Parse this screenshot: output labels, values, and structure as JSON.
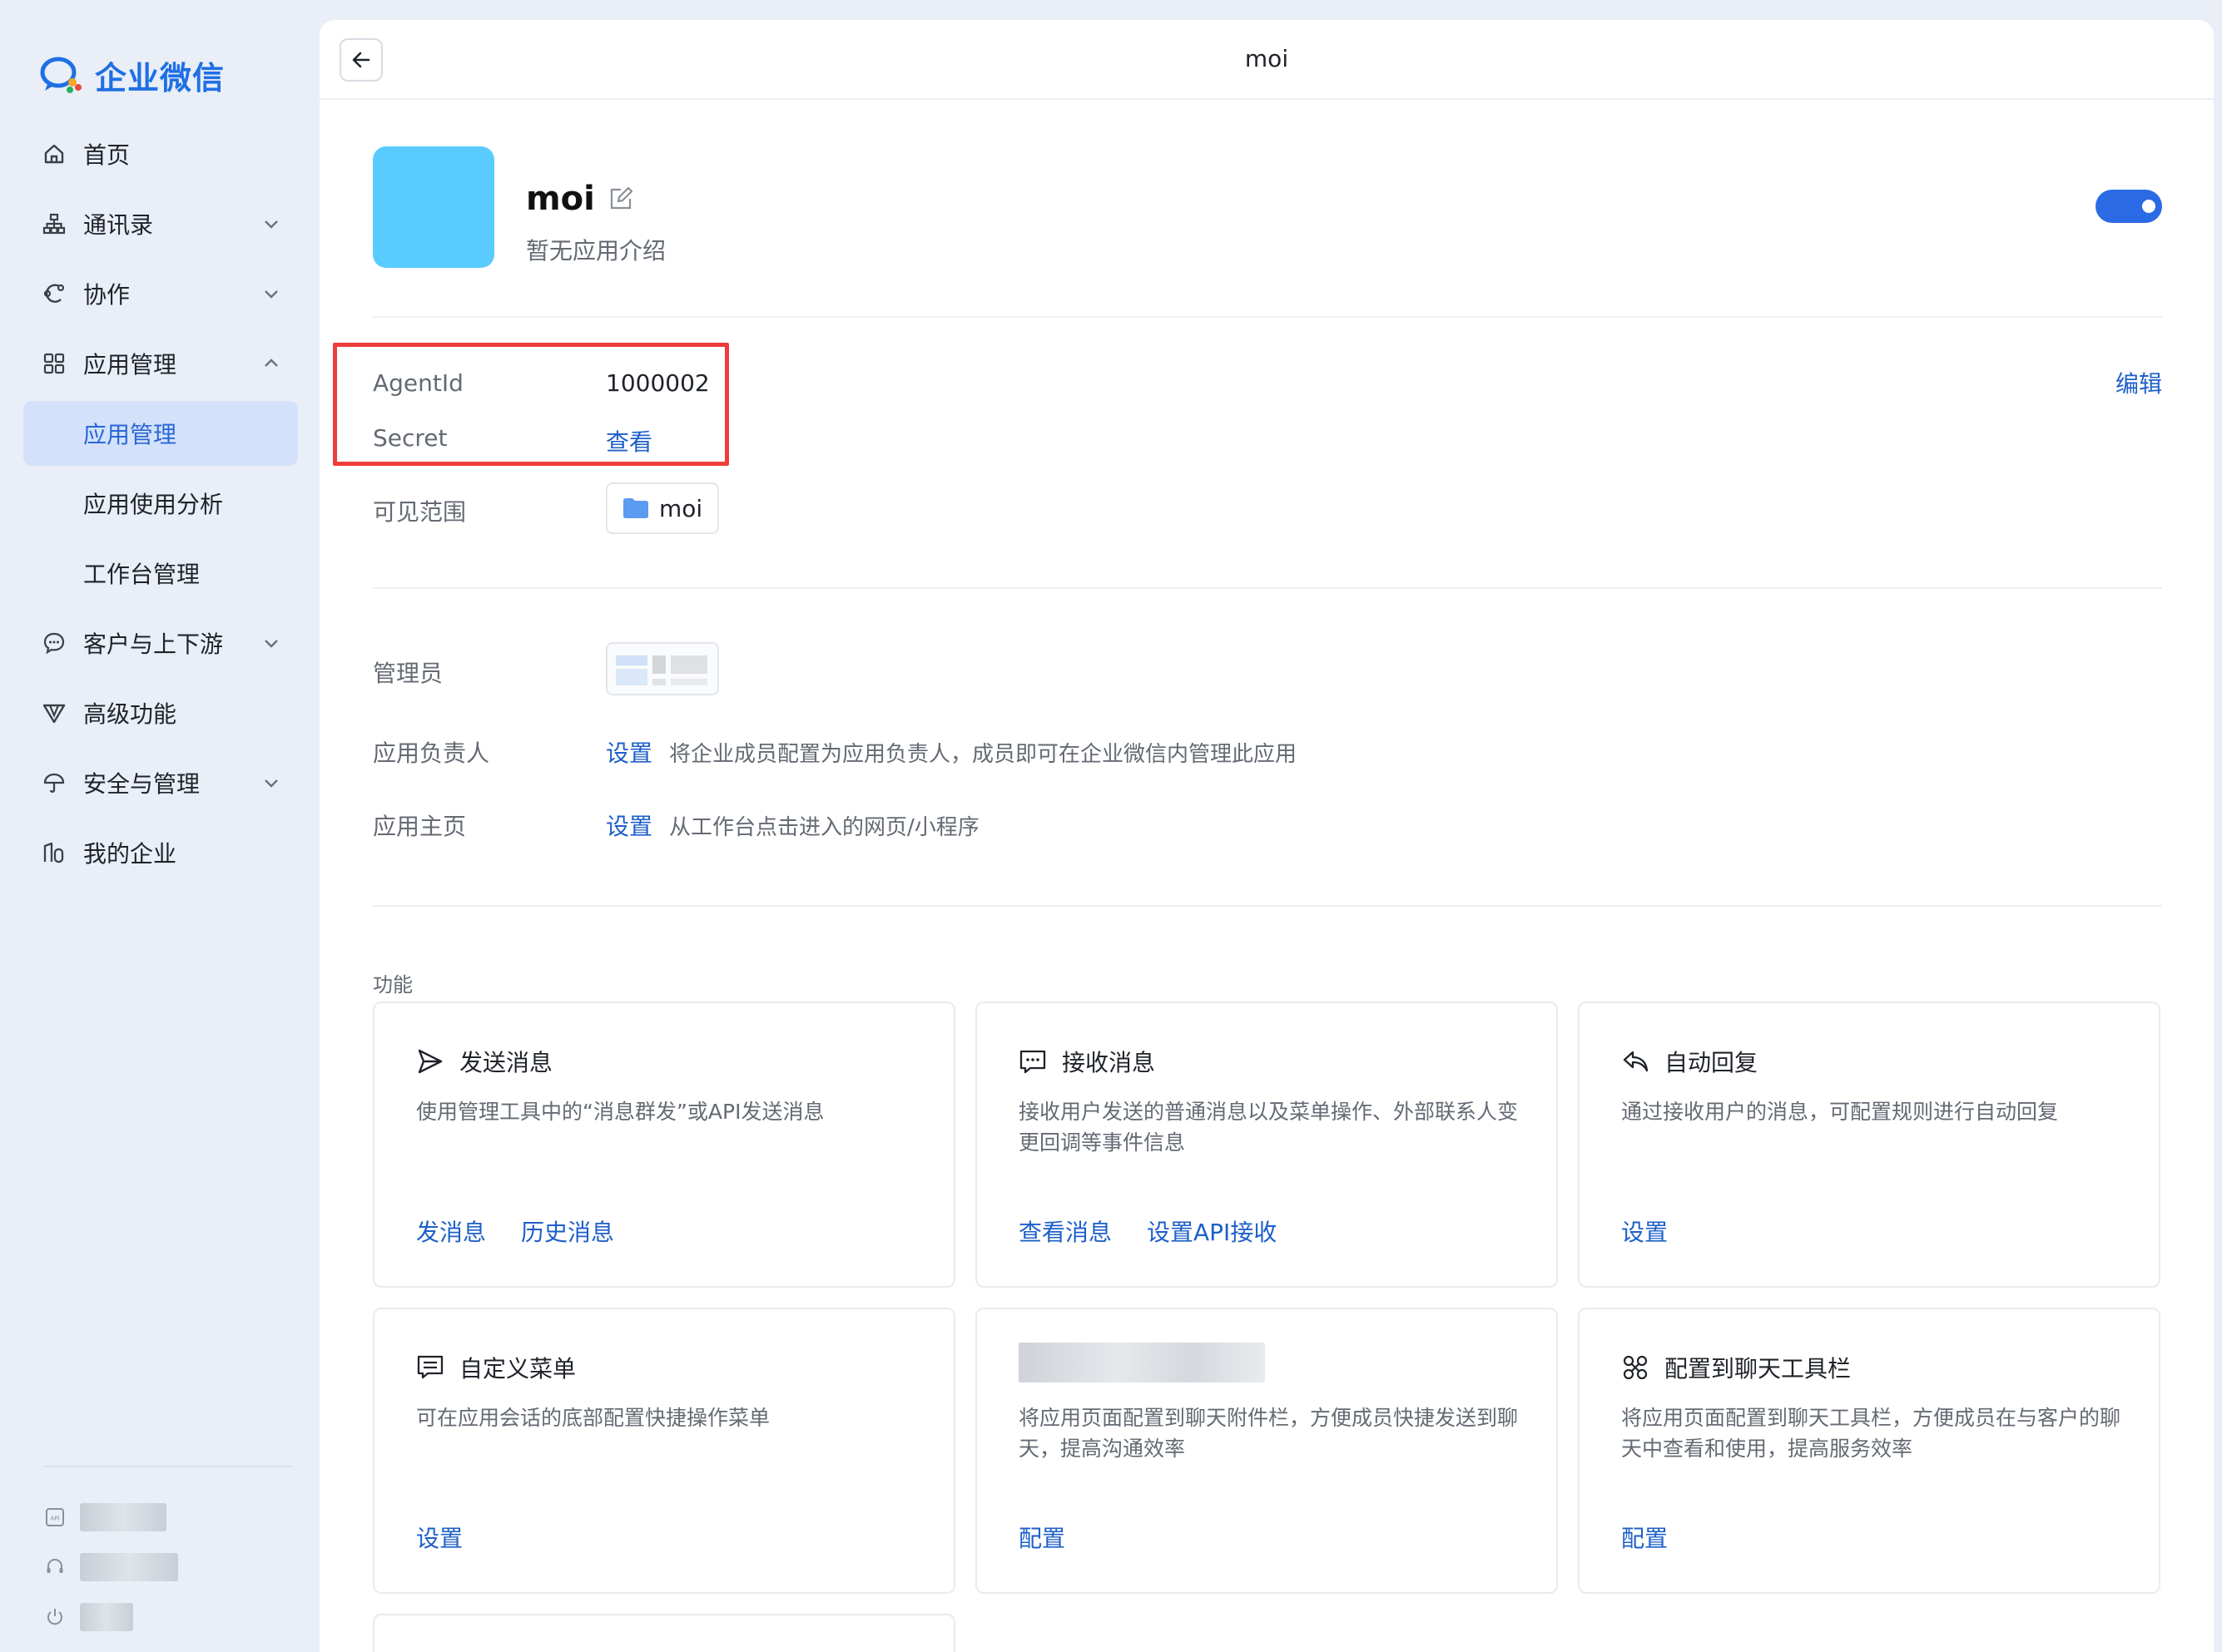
{
  "brand": {
    "name": "企业微信",
    "accent": "#1f6fe5"
  },
  "sidebar": {
    "items": [
      {
        "label": "首页",
        "icon": "home-icon"
      },
      {
        "label": "通讯录",
        "icon": "org-chart-icon"
      },
      {
        "label": "协作",
        "icon": "collaborate-icon"
      },
      {
        "label": "应用管理",
        "icon": "grid-icon"
      },
      {
        "label": "应用管理"
      },
      {
        "label": "应用使用分析"
      },
      {
        "label": "工作台管理"
      },
      {
        "label": "客户与上下游",
        "icon": "chat-bubble-icon"
      },
      {
        "label": "高级功能",
        "icon": "v-badge-icon"
      },
      {
        "label": "安全与管理",
        "icon": "umbrella-icon"
      },
      {
        "label": "我的企业",
        "icon": "building-icon"
      }
    ]
  },
  "topbar": {
    "title": "moi"
  },
  "app": {
    "name": "moi",
    "description": "暂无应用介绍",
    "enabled": true
  },
  "info": {
    "agentid_label": "AgentId",
    "agentid_value": "1000002",
    "secret_label": "Secret",
    "secret_link": "查看",
    "edit_link": "编辑",
    "visible_label": "可见范围",
    "visible_value": "moi"
  },
  "admin": {
    "admin_label": "管理员",
    "owner_label": "应用负责人",
    "owner_link": "设置",
    "owner_hint": "将企业成员配置为应用负责人，成员即可在企业微信内管理此应用",
    "home_label": "应用主页",
    "home_link": "设置",
    "home_hint": "从工作台点击进入的网页/小程序"
  },
  "features": {
    "section_label": "功能",
    "cards": [
      {
        "title": "发送消息",
        "desc": "使用管理工具中的“消息群发”或API发送消息",
        "links": [
          "发消息",
          "历史消息"
        ]
      },
      {
        "title": "接收消息",
        "desc": "接收用户发送的普通消息以及菜单操作、外部联系人变更回调等事件信息",
        "links": [
          "查看消息",
          "设置API接收"
        ]
      },
      {
        "title": "自动回复",
        "desc": "通过接收用户的消息，可配置规则进行自动回复",
        "links": [
          "设置"
        ]
      },
      {
        "title": "自定义菜单",
        "desc": "可在应用会话的底部配置快捷操作菜单",
        "links": [
          "设置"
        ]
      },
      {
        "title": "",
        "desc": "将应用页面配置到聊天附件栏，方便成员快捷发送到聊天，提高沟通效率",
        "links": [
          "配置"
        ]
      },
      {
        "title": "配置到聊天工具栏",
        "desc": "将应用页面配置到聊天工具栏，方便成员在与客户的聊天中查看和使用，提高服务效率",
        "links": [
          "配置"
        ]
      }
    ]
  },
  "colors": {
    "link": "#1e5fc8",
    "toggle_on": "#2a6ae4",
    "app_logo": "#59cbff",
    "highlight": "#ef3b3b"
  }
}
